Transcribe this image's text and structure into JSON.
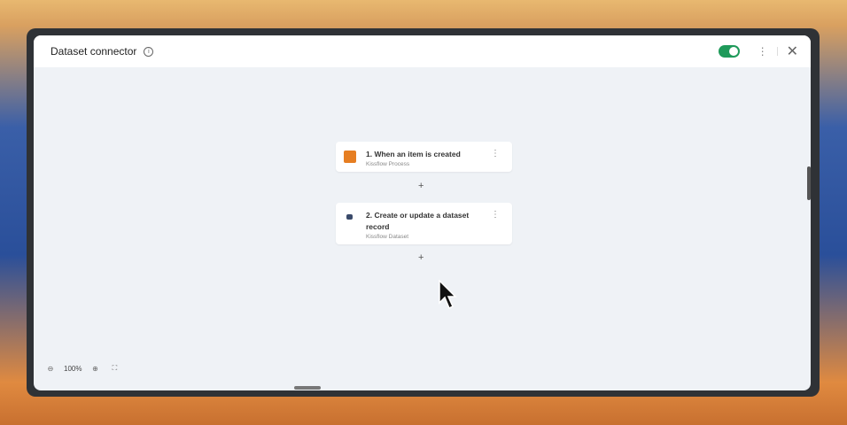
{
  "header": {
    "title": "Dataset connector",
    "enabled": true
  },
  "steps": [
    {
      "title": "1. When an item is created",
      "subtitle": "Kissflow Process",
      "color": "#e67e22"
    },
    {
      "title": "2. Create or update a dataset record",
      "subtitle": "Kissflow Dataset",
      "color": "#3a4a6a"
    }
  ],
  "add_step": "+",
  "zoom": {
    "level": "100%"
  }
}
